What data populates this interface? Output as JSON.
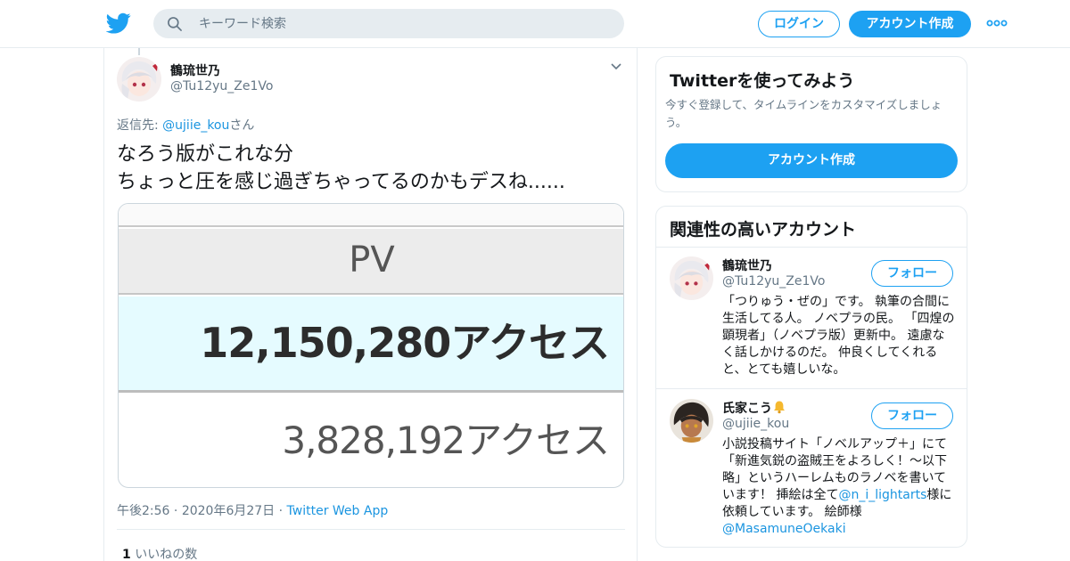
{
  "header": {
    "search_placeholder": "キーワード検索",
    "login_label": "ログイン",
    "signup_label": "アカウント作成",
    "more_icon": "more-dots-icon",
    "logo_icon": "twitter-bird-icon",
    "accent_color": "#1da1f2"
  },
  "tweet": {
    "author_name": "鶴琉世乃",
    "author_handle": "@Tu12yu_Ze1Vo",
    "reply_prefix": "返信先: ",
    "reply_target": "@ujiie_kou",
    "reply_suffix": "さん",
    "text_line1": "なろう版がこれな分",
    "text_line2": "ちょっと圧を感じ過ぎちゃってるのかもデスね......",
    "image": {
      "pv_header": "PV",
      "value_primary": "12,150,280アクセス",
      "value_secondary": "3,828,192アクセス"
    },
    "time": "午後2:56",
    "sep": " · ",
    "date": "2020年6月27日",
    "source": "Twitter Web App",
    "like_count": "1",
    "like_label": "いいねの数"
  },
  "signup_card": {
    "title": "Twitterを使ってみよう",
    "description": "今すぐ登録して、タイムラインをカスタマイズしましょう。",
    "button_label": "アカウント作成"
  },
  "related": {
    "title": "関連性の高いアカウント",
    "follow_label": "フォロー",
    "accounts": [
      {
        "name": "鶴琉世乃",
        "handle": "@Tu12yu_Ze1Vo",
        "bio": "「つりゅう・ぜの」です。 執筆の合間に生活してる人。 ノベプラの民。 「四煌の顕現者」（ノベプラ版）更新中。 遠慮なく話しかけるのだ。 仲良くしてくれると、とても嬉しいな。"
      },
      {
        "name": "氏家こう",
        "handle": "@ujiie_kou",
        "bio_before": "小説投稿サイト「ノベルアップ＋」にて「新進気鋭の盗賊王をよろしく！〜以下略」というハーレムものラノベを書いています！ 挿絵は全て",
        "bio_link1": "@n_i_lightarts",
        "bio_middle": "様に依頼しています。 絵師様 ",
        "bio_link2": "@MasamuneOekaki"
      }
    ]
  }
}
